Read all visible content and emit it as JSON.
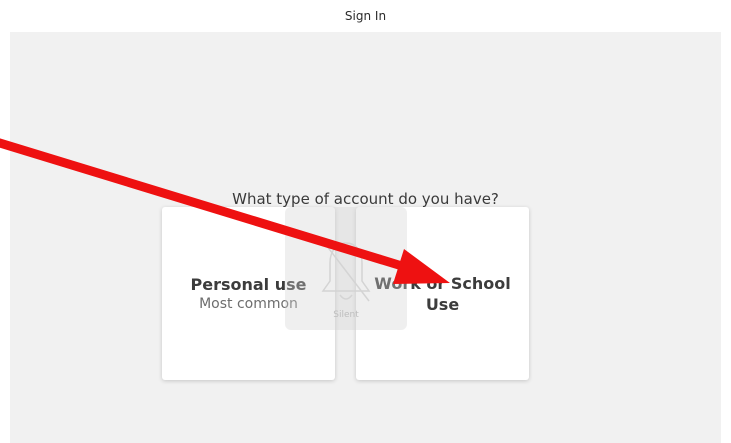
{
  "window": {
    "title": "Sign In"
  },
  "main": {
    "question": "What type of account do you have?",
    "cards": [
      {
        "title": "Personal use",
        "subtitle": "Most common"
      },
      {
        "title": "Work or School Use"
      }
    ]
  },
  "overlay": {
    "label": "Silent",
    "icon": "bell-slash-icon"
  },
  "annotation": {
    "icon": "red-arrow",
    "color": "#ee1111"
  },
  "colors": {
    "background": "#f1f1f1",
    "card": "#ffffff",
    "arrow": "#ee1111"
  }
}
